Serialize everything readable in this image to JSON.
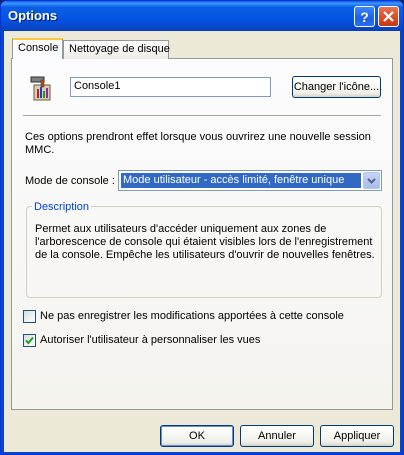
{
  "window": {
    "title": "Options"
  },
  "tabs": [
    {
      "label": "Console",
      "active": true
    },
    {
      "label": "Nettoyage de disque",
      "active": false
    }
  ],
  "console": {
    "name_value": "Console1",
    "change_icon_label": "Changer l'icône...",
    "info_line1": "Ces options prendront effet lorsque vous ouvrirez une nouvelle session",
    "info_line2": "MMC.",
    "mode_label": "Mode de console :",
    "mode_value": "Mode utilisateur  - accès limité, fenêtre unique",
    "description_legend": "Description",
    "description_line1": "Permet aux utilisateurs d'accéder uniquement aux zones de",
    "description_line2": "l'arborescence de console qui étaient visibles lors de l'enregistrement",
    "description_line3": "de la console. Empêche les utilisateurs d'ouvrir de nouvelles fenêtres.",
    "checkbox_no_save": {
      "label": "Ne pas enregistrer les modifications apportées à cette console",
      "checked": false
    },
    "checkbox_customize": {
      "label": "Autoriser l'utilisateur à personnaliser les vues",
      "checked": true
    }
  },
  "buttons": {
    "ok": "OK",
    "cancel": "Annuler",
    "apply": "Appliquer"
  },
  "colors": {
    "titlebar": "#0a5fe4",
    "selection": "#316ac5",
    "group_legend": "#0046d5"
  }
}
